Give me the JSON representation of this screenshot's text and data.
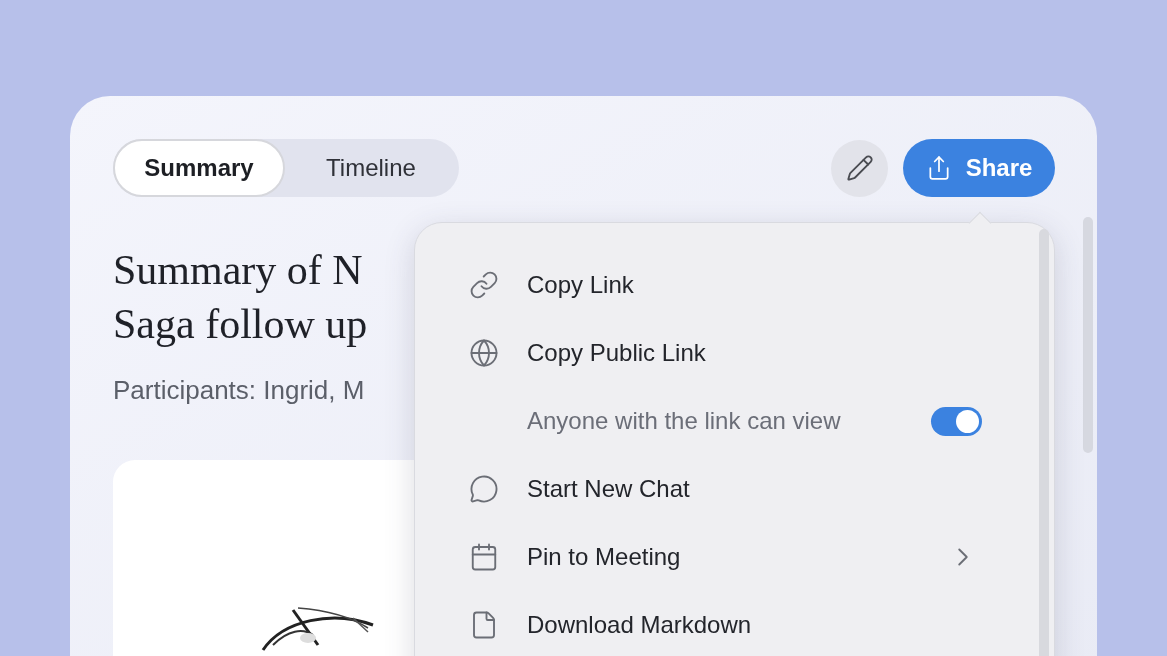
{
  "tabs": [
    {
      "label": "Summary",
      "selected": true
    },
    {
      "label": "Timeline",
      "selected": false
    }
  ],
  "share_button": {
    "label": "Share"
  },
  "title_lines": [
    "Summary of N",
    "Saga follow up"
  ],
  "participants": "Participants: Ingrid, M",
  "share_menu": {
    "items": [
      {
        "kind": "action",
        "label": "Copy Link"
      },
      {
        "kind": "action",
        "label": "Copy Public Link"
      },
      {
        "kind": "toggle",
        "label": "Anyone with the link can view",
        "on": true
      },
      {
        "kind": "action",
        "label": "Start New Chat"
      },
      {
        "kind": "submenu",
        "label": "Pin to Meeting"
      },
      {
        "kind": "action",
        "label": "Download Markdown"
      }
    ]
  }
}
